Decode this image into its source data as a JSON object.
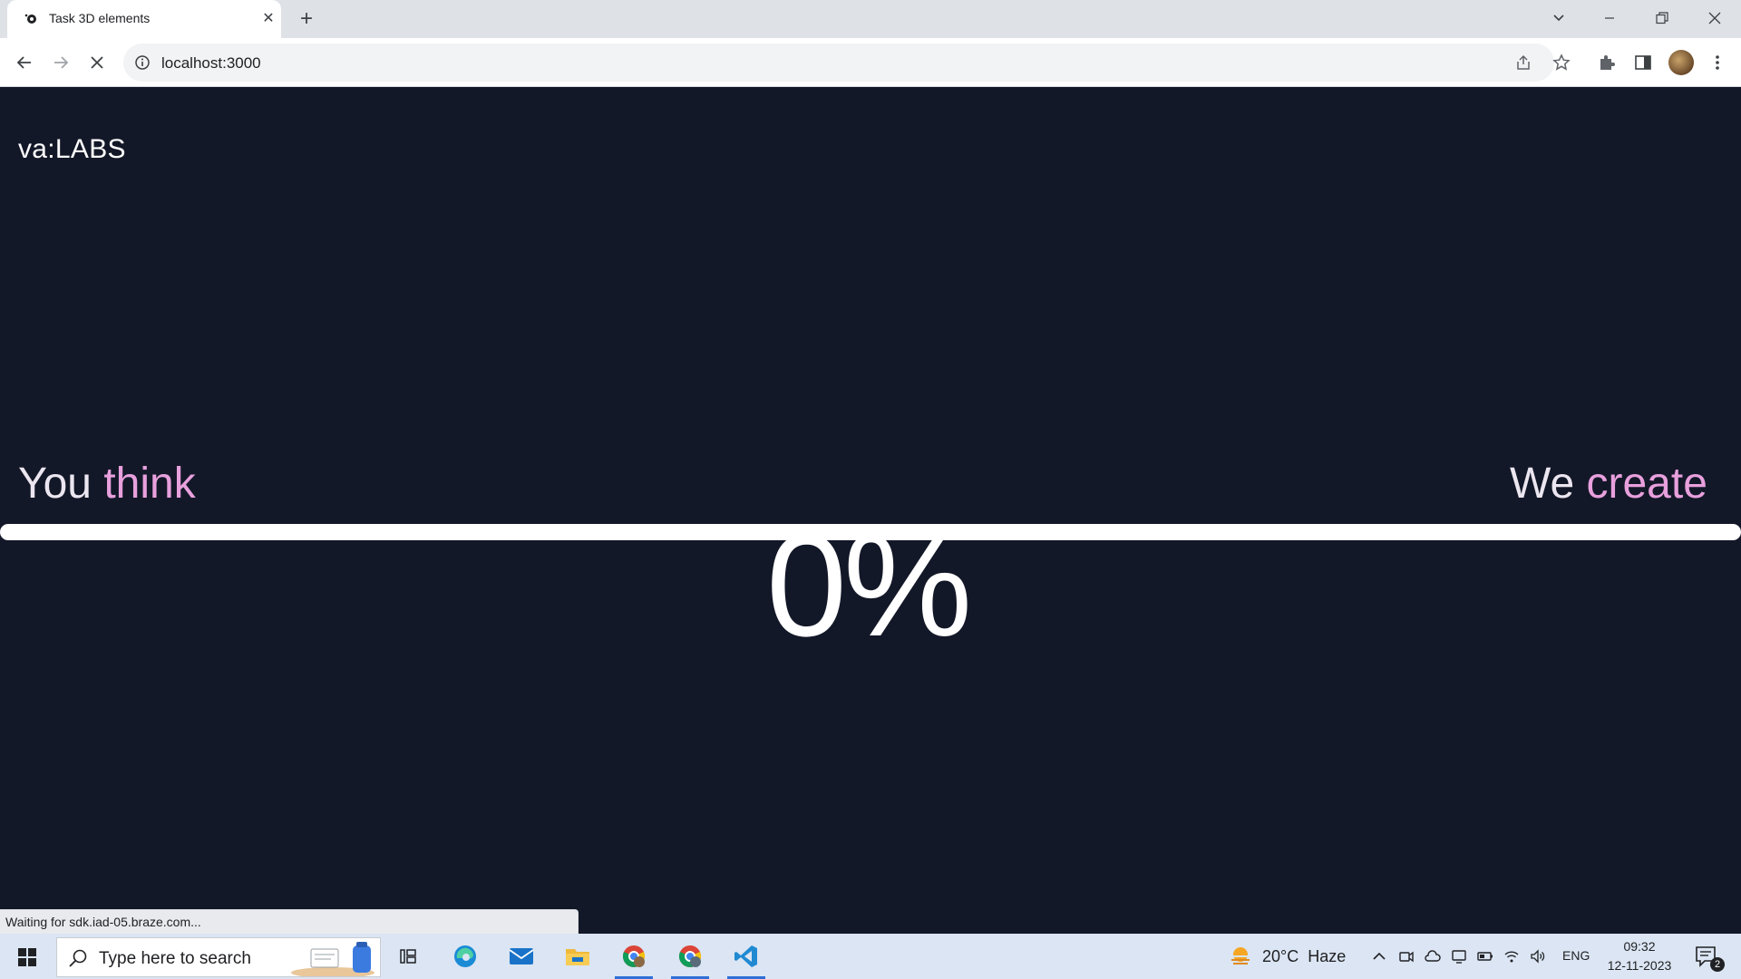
{
  "browser": {
    "tab_title": "Task 3D elements",
    "url": "localhost:3000",
    "status_text": "Waiting for sdk.iad-05.braze.com..."
  },
  "page": {
    "logo_prefix": "va:",
    "logo_main": "LABS",
    "left_word1": "You",
    "left_word2": "think",
    "right_word1": "We",
    "right_word2": "create",
    "progress_text": "0%",
    "progress_fraction": 0.0,
    "colors": {
      "background": "#131828",
      "accent_pink": "#e8a0dd",
      "text_light": "#ece6f0"
    }
  },
  "taskbar": {
    "search_placeholder": "Type here to search",
    "weather_temp": "20°C",
    "weather_desc": "Haze",
    "language": "ENG",
    "time": "09:32",
    "date": "12-11-2023",
    "notification_count": "2"
  }
}
